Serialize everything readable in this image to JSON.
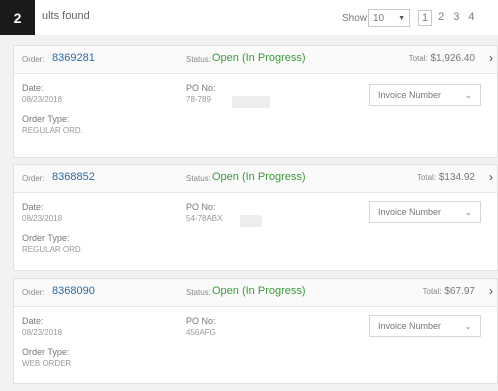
{
  "step_badge": "2",
  "header": {
    "results_text": "ults found",
    "show_label": "Show:",
    "show_value": "10",
    "pages": [
      "1",
      "2",
      "3",
      "4"
    ]
  },
  "orders": [
    {
      "order_label": "Order:",
      "order_number": "8369281",
      "status_label": "Status:",
      "status_value": "Open (In Progress)",
      "total_label": "Total:",
      "total_value": "$1,926.40",
      "date_label": "Date:",
      "date_value": "08/23/2018",
      "po_label": "PO No:",
      "po_value": "78-789",
      "order_type_label": "Order Type:",
      "order_type_value": "REGULAR ORD.",
      "invoice_select": "Invoice Number"
    },
    {
      "order_label": "Order:",
      "order_number": "8368852",
      "status_label": "Status:",
      "status_value": "Open (In Progress)",
      "total_label": "Total:",
      "total_value": "$134.92",
      "date_label": "Date:",
      "date_value": "08/23/2018",
      "po_label": "PO No:",
      "po_value": "54-78ABX",
      "order_type_label": "Order Type:",
      "order_type_value": "REGULAR ORD.",
      "invoice_select": "Invoice Number"
    },
    {
      "order_label": "Order:",
      "order_number": "8368090",
      "status_label": "Status:",
      "status_value": "Open (In Progress)",
      "total_label": "Total:",
      "total_value": "$67.97",
      "date_label": "Date:",
      "date_value": "08/23/2018",
      "po_label": "PO No:",
      "po_value": "456AFG",
      "order_type_label": "Order Type:",
      "order_type_value": "WEB ORDER",
      "invoice_select": "Invoice Number"
    }
  ]
}
